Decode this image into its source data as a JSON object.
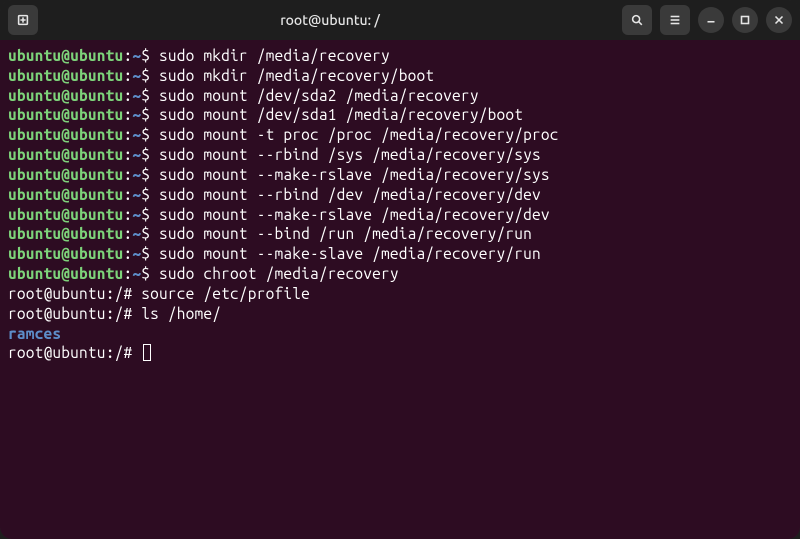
{
  "titlebar": {
    "title": "root@ubuntu: /"
  },
  "prompt_ubuntu": {
    "user_host": "ubuntu@ubuntu",
    "sep": ":",
    "path": "~",
    "sigil": "$"
  },
  "prompt_root": {
    "user_host": "root@ubuntu",
    "sep": ":",
    "path": "/",
    "sigil": "#"
  },
  "lines": [
    "sudo mkdir /media/recovery",
    "sudo mkdir /media/recovery/boot",
    "sudo mount /dev/sda2 /media/recovery",
    "sudo mount /dev/sda1 /media/recovery/boot",
    "sudo mount -t proc /proc /media/recovery/proc",
    "sudo mount --rbind /sys /media/recovery/sys",
    "sudo mount --make-rslave /media/recovery/sys",
    "sudo mount --rbind /dev /media/recovery/dev",
    "sudo mount --make-rslave /media/recovery/dev",
    "sudo mount --bind /run /media/recovery/run",
    "sudo mount --make-slave /media/recovery/run",
    "sudo chroot /media/recovery"
  ],
  "root_lines": [
    "source /etc/profile",
    "ls /home/"
  ],
  "ls_output": "ramces"
}
